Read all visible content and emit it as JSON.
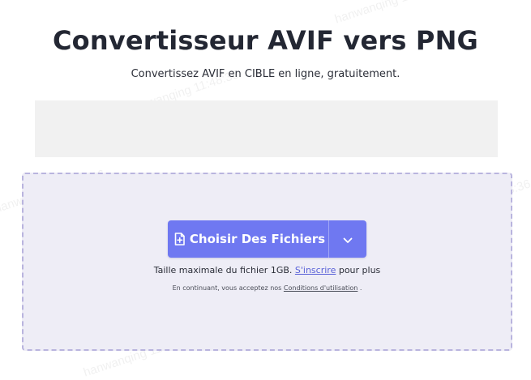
{
  "header": {
    "title": "Convertisseur AVIF vers PNG",
    "subtitle": "Convertissez AVIF en CIBLE en ligne, gratuitement."
  },
  "upload": {
    "choose_label": "Choisir Des Fichiers",
    "size_prefix": "Taille maximale du fichier 1GB.",
    "signup_link": "S'inscrire",
    "size_suffix": "pour plus",
    "terms_prefix": "En continuant, vous acceptez nos",
    "terms_link": "Conditions d'utilisation",
    "terms_suffix": "."
  },
  "watermark": {
    "text": "hanwanqing 11:48:36"
  },
  "colors": {
    "accent": "#6f78f1",
    "dropzone_bg": "#eeedf6",
    "dropzone_border": "#b9b4de",
    "ad_bg": "#f1f1f1"
  },
  "icons": {
    "file_add": "file-plus-icon",
    "dropdown": "chevron-down-icon"
  }
}
